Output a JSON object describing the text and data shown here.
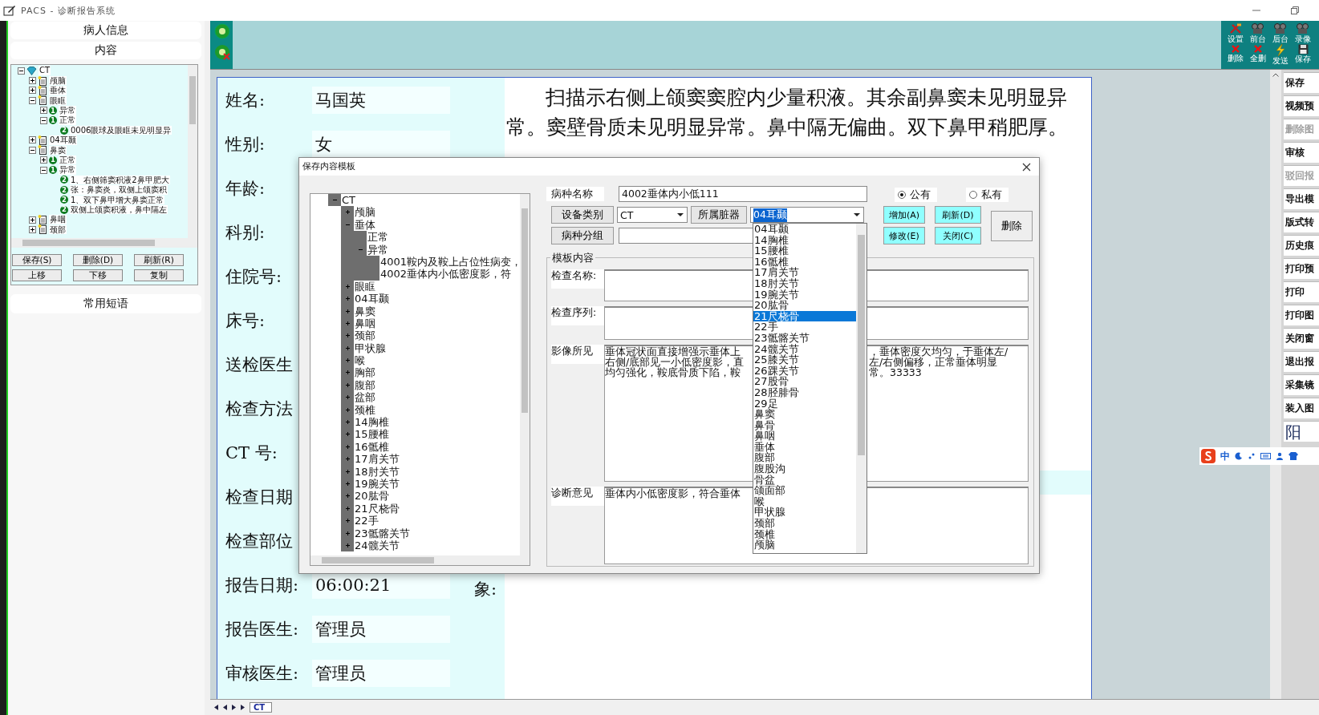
{
  "window": {
    "title": "PACS - 诊断报告系统"
  },
  "sidebar": {
    "headers": [
      "病人信息",
      "内容"
    ],
    "tree": [
      {
        "label": "CT",
        "expanded": true,
        "children": [
          {
            "label": "颅脑",
            "expanded": false
          },
          {
            "label": "垂体",
            "expanded": false
          },
          {
            "label": "眼眶",
            "expanded": true,
            "children": [
              {
                "label": "异常",
                "badge": "1",
                "expanded": false
              },
              {
                "label": "正常",
                "badge": "1",
                "expanded": true,
                "children": [
                  {
                    "label": "0006眼球及眼眶未见明显异",
                    "badge": "2"
                  }
                ]
              }
            ]
          },
          {
            "label": "04耳颞",
            "expanded": false
          },
          {
            "label": "鼻窦",
            "expanded": true,
            "children": [
              {
                "label": "正常",
                "badge": "1",
                "expanded": false
              },
              {
                "label": "异常",
                "badge": "1",
                "expanded": true,
                "children": [
                  {
                    "label": "1、右侧筛窦积液2鼻甲肥大",
                    "badge": "2"
                  },
                  {
                    "label": "张：鼻窦炎，双侧上颌窦积",
                    "badge": "2"
                  },
                  {
                    "label": "1、双下鼻甲增大鼻窦正常",
                    "badge": "2"
                  },
                  {
                    "label": "双侧上颌窦积液，鼻中隔左",
                    "badge": "2"
                  }
                ]
              }
            ]
          },
          {
            "label": "鼻咽",
            "expanded": false
          },
          {
            "label": "颈部",
            "expanded": false
          }
        ]
      }
    ],
    "buttons": [
      "保存(S)",
      "删除(D)",
      "刷新(R)",
      "上移",
      "下移",
      "复制"
    ],
    "phrases_header": "常用短语"
  },
  "toolbar": {
    "tools": [
      {
        "label": "设置",
        "kind": "tools"
      },
      {
        "label": "前台",
        "kind": "reel"
      },
      {
        "label": "后台",
        "kind": "reel"
      },
      {
        "label": "录像",
        "kind": "reel"
      },
      {
        "label": "删除",
        "kind": "delete"
      },
      {
        "label": "全删",
        "kind": "delete"
      },
      {
        "label": "发送",
        "kind": "bolt"
      },
      {
        "label": "保存",
        "kind": "disk"
      }
    ]
  },
  "report": {
    "fields": [
      {
        "label": "姓名:",
        "value": "马国英"
      },
      {
        "label": "性别:",
        "value": "女"
      },
      {
        "label": "年龄:"
      },
      {
        "label": "科别:"
      },
      {
        "label": "住院号:"
      },
      {
        "label": "床号:"
      },
      {
        "label": "送检医生"
      },
      {
        "label": "检查方法"
      },
      {
        "label": "CT 号:"
      },
      {
        "label": "检查日期"
      },
      {
        "label": "检查部位"
      },
      {
        "label": "报告日期:",
        "value": "06:00:21"
      },
      {
        "label": "报告医生:",
        "value": "管理员"
      },
      {
        "label": "审核医生:",
        "value": "管理员"
      }
    ],
    "findings": "扫描示右侧上颌窦窦腔内少量积液。其余副鼻窦未见明显异常。窦壁骨质未见明显异常。鼻中隔无偏曲。双下鼻甲稍肥厚。",
    "impression_label": "象:"
  },
  "side_buttons": [
    {
      "label": "保存",
      "kind": "button",
      "disabled": false
    },
    {
      "label": "视频预",
      "kind": "button",
      "disabled": false
    },
    {
      "label": "删除图",
      "kind": "button",
      "disabled": true
    },
    {
      "label": "审核",
      "kind": "button",
      "disabled": false
    },
    {
      "label": "驳回报",
      "kind": "button",
      "disabled": true
    },
    {
      "label": "导出模",
      "kind": "button",
      "disabled": false
    },
    {
      "label": "版式转",
      "kind": "button",
      "disabled": false
    },
    {
      "label": "历史痕",
      "kind": "button",
      "disabled": false
    },
    {
      "label": "打印预",
      "kind": "button",
      "disabled": false
    },
    {
      "label": "打印",
      "kind": "button",
      "disabled": false
    },
    {
      "label": "打印图",
      "kind": "button",
      "disabled": false
    },
    {
      "label": "关闭窗",
      "kind": "button",
      "disabled": false
    },
    {
      "label": "退出报",
      "kind": "button",
      "disabled": false
    },
    {
      "label": "采集镜",
      "kind": "button",
      "disabled": false
    },
    {
      "label": "装入图",
      "kind": "button",
      "disabled": false
    },
    {
      "label": "阳",
      "kind": "large",
      "disabled": false
    }
  ],
  "ime": {
    "label": "中"
  },
  "sheet_tabs": [
    {
      "label": "CT",
      "selected": true
    }
  ],
  "dialog": {
    "title": "保存内容模板",
    "tree": [
      {
        "label": "CT",
        "expanded": true,
        "children": [
          {
            "label": "颅脑",
            "expanded": false
          },
          {
            "label": "垂体",
            "expanded": true,
            "children": [
              {
                "label": "正常"
              },
              {
                "label": "异常",
                "expanded": true,
                "children": [
                  {
                    "label": "4001鞍内及鞍上占位性病变，"
                  },
                  {
                    "label": "4002垂体内小低密度影，符"
                  }
                ]
              }
            ]
          },
          {
            "label": "眼眶",
            "expanded": false
          },
          {
            "label": "04耳颞",
            "expanded": false
          },
          {
            "label": "鼻窦",
            "expanded": false
          },
          {
            "label": "鼻咽",
            "expanded": false
          },
          {
            "label": "颈部",
            "expanded": false
          },
          {
            "label": "甲状腺",
            "expanded": false
          },
          {
            "label": "喉",
            "expanded": false
          },
          {
            "label": "胸部",
            "expanded": false
          },
          {
            "label": "腹部",
            "expanded": false
          },
          {
            "label": "盆部",
            "expanded": false
          },
          {
            "label": "颈椎",
            "expanded": false
          },
          {
            "label": "14胸椎",
            "expanded": false
          },
          {
            "label": "15腰椎",
            "expanded": false
          },
          {
            "label": "16骶椎",
            "expanded": false
          },
          {
            "label": "17肩关节",
            "expanded": false
          },
          {
            "label": "18肘关节",
            "expanded": false
          },
          {
            "label": "19腕关节",
            "expanded": false
          },
          {
            "label": "20肱骨",
            "expanded": false
          },
          {
            "label": "21尺桡骨",
            "expanded": false
          },
          {
            "label": "22手",
            "expanded": false
          },
          {
            "label": "23骶髂关节",
            "expanded": false
          },
          {
            "label": "24髋关节",
            "expanded": false
          }
        ]
      }
    ],
    "name_label": "病种名称",
    "name_value": "4002垂体内小低111",
    "visibility": [
      {
        "label": "公有",
        "selected": true
      },
      {
        "label": "私有",
        "selected": false
      }
    ],
    "device_button": "设备类别",
    "device_value": "CT",
    "organ_button": "所属脏器",
    "organ_value": "04耳颞",
    "group_button": "病种分组",
    "actions": [
      {
        "label": "增加(A)",
        "kind": "accent"
      },
      {
        "label": "刷新(D)",
        "kind": "accent"
      },
      {
        "label": "修改(E)",
        "kind": "accent"
      },
      {
        "label": "关闭(C)",
        "kind": "accent"
      },
      {
        "label": "删除",
        "kind": "plain"
      }
    ],
    "template": {
      "title": "模板内容",
      "fields": [
        {
          "label": "检查名称:"
        },
        {
          "label": "检查序列:"
        },
        {
          "label": "影像所见",
          "lines": [
            {
              "left": "垂体冠状面直接增强示垂体上",
              "right": "，垂体密度欠均匀，于垂体左/"
            },
            {
              "left": "右侧/底部见一小低密度影，直",
              "right": "左/右侧偏移，正常垂体明显"
            },
            {
              "left": "均匀强化，鞍底骨质下陷，鞍",
              "right": "常。33333"
            }
          ]
        },
        {
          "label": "诊断意见",
          "lines": [
            {
              "left": "垂体内小低密度影，符合垂体"
            }
          ]
        }
      ]
    },
    "organ_list": [
      {
        "label": "04耳颞",
        "selected": false
      },
      {
        "label": "14胸椎",
        "selected": false
      },
      {
        "label": "15腰椎",
        "selected": false
      },
      {
        "label": "16骶椎",
        "selected": false
      },
      {
        "label": "17肩关节",
        "selected": false
      },
      {
        "label": "18肘关节",
        "selected": false
      },
      {
        "label": "19腕关节",
        "selected": false
      },
      {
        "label": "20肱骨",
        "selected": false
      },
      {
        "label": "21尺桡骨",
        "selected": true
      },
      {
        "label": "22手",
        "selected": false
      },
      {
        "label": "23骶髂关节",
        "selected": false
      },
      {
        "label": "24髋关节",
        "selected": false
      },
      {
        "label": "25膝关节",
        "selected": false
      },
      {
        "label": "26踝关节",
        "selected": false
      },
      {
        "label": "27股骨",
        "selected": false
      },
      {
        "label": "28胫腓骨",
        "selected": false
      },
      {
        "label": "29足",
        "selected": false
      },
      {
        "label": "鼻窦",
        "selected": false
      },
      {
        "label": "鼻骨",
        "selected": false
      },
      {
        "label": "鼻咽",
        "selected": false
      },
      {
        "label": "垂体",
        "selected": false
      },
      {
        "label": "腹部",
        "selected": false
      },
      {
        "label": "腹股沟",
        "selected": false
      },
      {
        "label": "骨盆",
        "selected": false
      },
      {
        "label": "颌面部",
        "selected": false
      },
      {
        "label": "喉",
        "selected": false
      },
      {
        "label": "甲状腺",
        "selected": false
      },
      {
        "label": "颈部",
        "selected": false
      },
      {
        "label": "颈椎",
        "selected": false
      },
      {
        "label": "颅脑",
        "selected": false
      }
    ]
  }
}
